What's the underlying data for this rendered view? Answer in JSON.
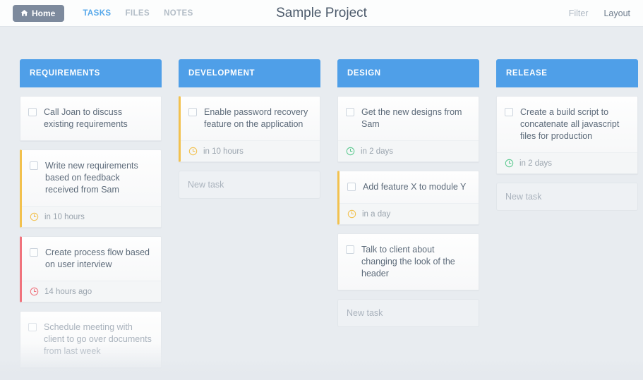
{
  "topbar": {
    "home_label": "Home",
    "home_icon": "home-icon",
    "tabs": [
      {
        "label": "TASKS",
        "active": true
      },
      {
        "label": "FILES",
        "active": false
      },
      {
        "label": "NOTES",
        "active": false
      }
    ],
    "project_title": "Sample Project",
    "right_links": [
      {
        "label": "Filter"
      },
      {
        "label": "Layout"
      }
    ]
  },
  "theme": {
    "header_blue": "#4f9fe8",
    "accent_yellow": "#f2c14e",
    "accent_red": "#f0737d",
    "accent_green": "#5bc98f",
    "page_background": "#e8ecf0",
    "tab_active": "#56a8ea"
  },
  "board": {
    "new_task_placeholder": "New task",
    "columns": [
      {
        "title": "REQUIREMENTS",
        "has_new_task": false,
        "cards": [
          {
            "title": "Call Joan to discuss existing requirements",
            "accent": "none",
            "muted": false,
            "due": null,
            "due_state": null
          },
          {
            "title": "Write new requirements based on feedback received from Sam",
            "accent": "yellow",
            "muted": false,
            "due": "in 10 hours",
            "due_state": "soon"
          },
          {
            "title": "Create process flow based on user interview",
            "accent": "red",
            "muted": false,
            "due": "14 hours ago",
            "due_state": "overdue"
          },
          {
            "title": "Schedule meeting with client to go over documents from last week",
            "accent": "none",
            "muted": true,
            "due": null,
            "due_state": null
          }
        ]
      },
      {
        "title": "DEVELOPMENT",
        "has_new_task": true,
        "cards": [
          {
            "title": "Enable password recovery feature on the application",
            "accent": "yellow",
            "muted": false,
            "due": "in 10 hours",
            "due_state": "soon"
          }
        ]
      },
      {
        "title": "DESIGN",
        "has_new_task": true,
        "cards": [
          {
            "title": "Get the new designs from Sam",
            "accent": "none",
            "muted": false,
            "due": "in 2 days",
            "due_state": "ok"
          },
          {
            "title": "Add feature X to module Y",
            "accent": "yellow",
            "muted": false,
            "due": "in a day",
            "due_state": "soon"
          },
          {
            "title": "Talk to client about changing the look of the header",
            "accent": "none",
            "muted": false,
            "due": null,
            "due_state": null
          }
        ]
      },
      {
        "title": "RELEASE",
        "has_new_task": true,
        "cards": [
          {
            "title": "Create a build script to concatenate all javascript files for production",
            "accent": "none",
            "muted": false,
            "due": "in 2 days",
            "due_state": "ok"
          }
        ]
      }
    ]
  }
}
